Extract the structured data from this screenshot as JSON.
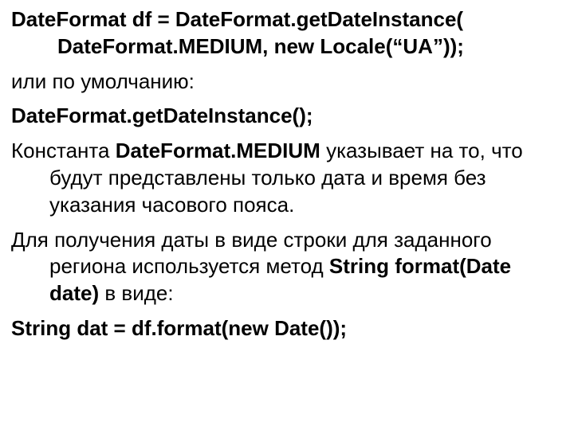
{
  "slide": {
    "p1_b1": "DateFormat df = DateFormat.getDateInstance(",
    "p1_b2_indent": "DateFormat.MEDIUM, new Locale(“UA”));",
    "p2": "или по умолчанию:",
    "p3_b": " DateFormat.getDateInstance();",
    "p4_prefix": "Константа ",
    "p4_b": "DateFormat.MEDIUM",
    "p4_suffix": " указывает на то, что будут представлены только дата и время без указания часового пояса.",
    "p5_prefix": "Для получения даты в виде строки для заданного региона используется метод ",
    "p5_b": "String format(Date date)",
    "p5_suffix": " в виде:",
    "p6_b": " String dat = df.format(new Date());"
  }
}
